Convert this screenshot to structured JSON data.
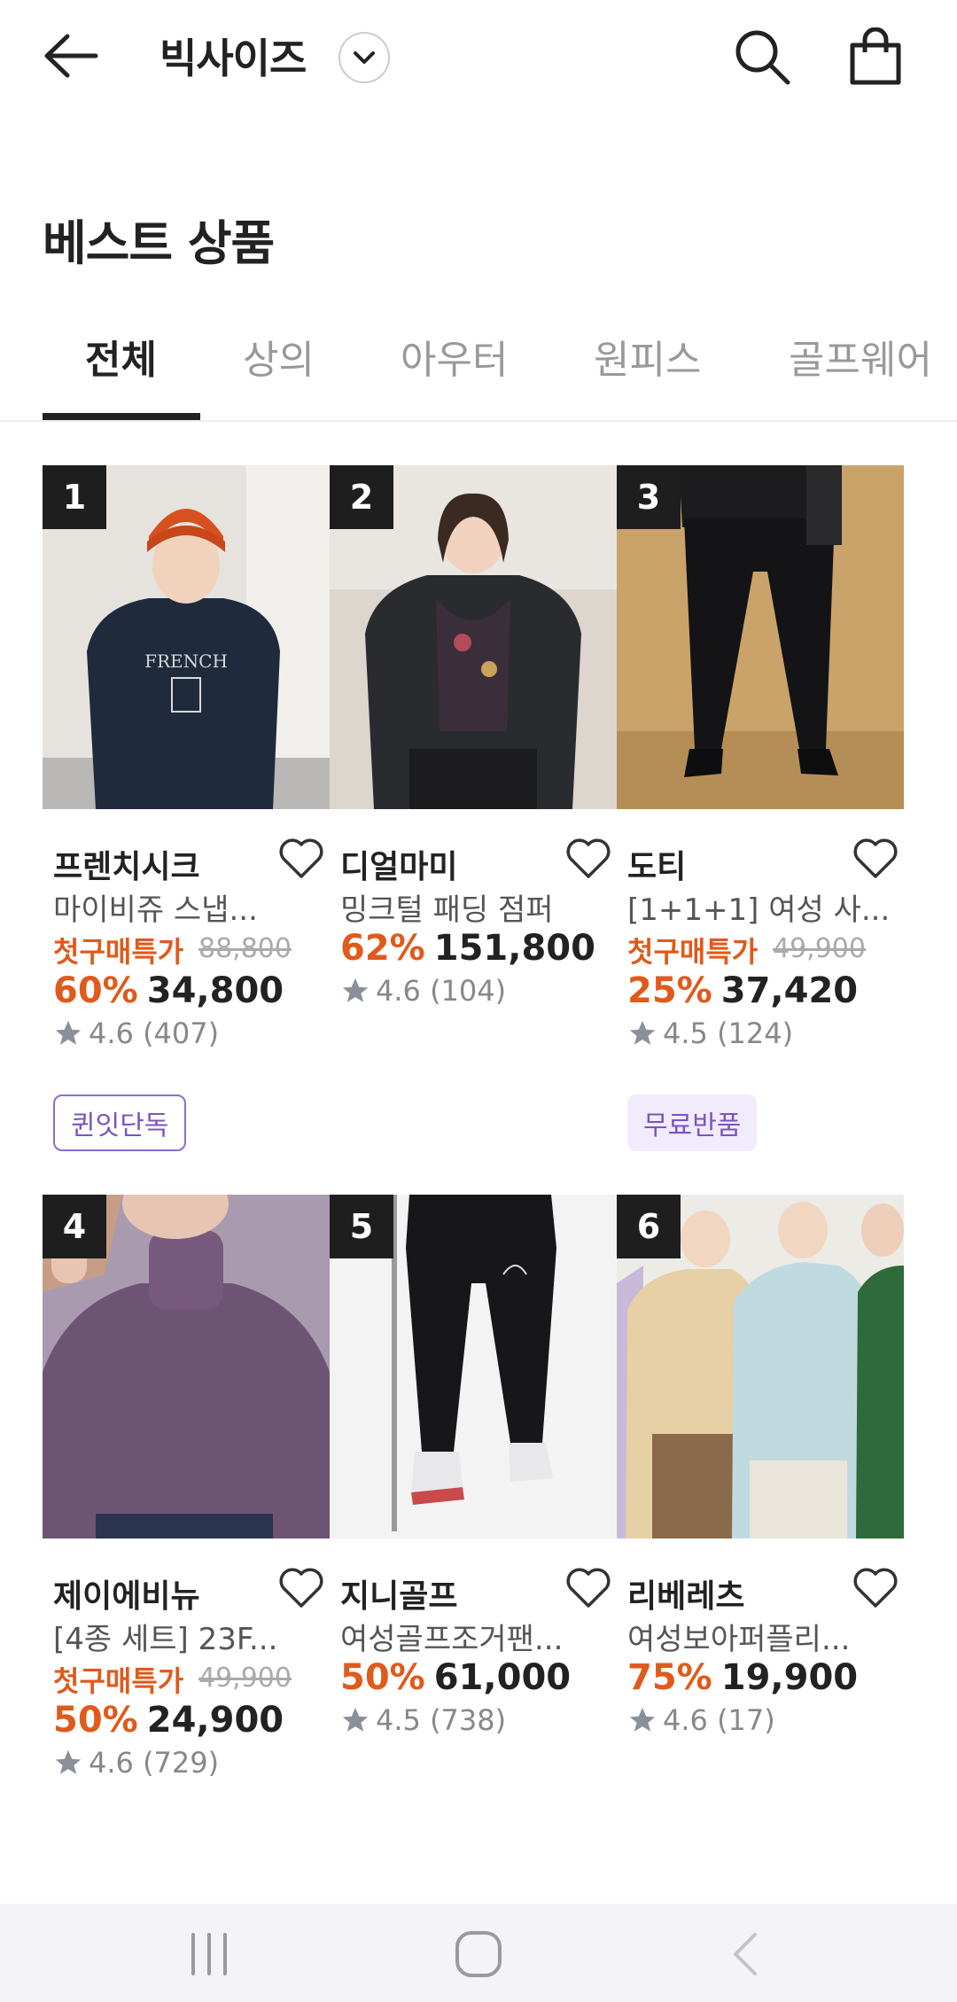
{
  "header": {
    "store_title": "빅사이즈",
    "back_icon": "arrow-left-icon",
    "dropdown_icon": "chevron-down-icon",
    "search_icon": "search-icon",
    "bag_icon": "shopping-bag-icon"
  },
  "section_title": "베스트 상품",
  "tabs": [
    {
      "label": "전체",
      "active": true
    },
    {
      "label": "상의",
      "active": false
    },
    {
      "label": "아우터",
      "active": false
    },
    {
      "label": "원피스",
      "active": false
    },
    {
      "label": "골프웨어",
      "active": false
    }
  ],
  "products": [
    {
      "rank": "1",
      "brand": "프렌치시크",
      "name": "마이비쥬 스냅...",
      "promo": "첫구매특가",
      "original_price": "88,800",
      "discount": "60%",
      "price": "34,800",
      "rating": "4.6",
      "reviews": "(407)",
      "badge": "퀸잇단독"
    },
    {
      "rank": "2",
      "brand": "디얼마미",
      "name": "밍크털 패딩 점퍼",
      "promo": "",
      "original_price": "",
      "discount": "62%",
      "price": "151,800",
      "rating": "4.6",
      "reviews": "(104)",
      "badge": ""
    },
    {
      "rank": "3",
      "brand": "도티",
      "name": "[1+1+1] 여성 사...",
      "promo": "첫구매특가",
      "original_price": "49,900",
      "discount": "25%",
      "price": "37,420",
      "rating": "4.5",
      "reviews": "(124)",
      "badge": "무료반품"
    },
    {
      "rank": "4",
      "brand": "제이에비뉴",
      "name": "[4종 세트] 23F...",
      "promo": "첫구매특가",
      "original_price": "49,900",
      "discount": "50%",
      "price": "24,900",
      "rating": "4.6",
      "reviews": "(729)",
      "badge": ""
    },
    {
      "rank": "5",
      "brand": "지니골프",
      "name": "여성골프조거팬...",
      "promo": "",
      "original_price": "",
      "discount": "50%",
      "price": "61,000",
      "rating": "4.5",
      "reviews": "(738)",
      "badge": ""
    },
    {
      "rank": "6",
      "brand": "리베레츠",
      "name": "여성보아퍼플리...",
      "promo": "",
      "original_price": "",
      "discount": "75%",
      "price": "19,900",
      "rating": "4.6",
      "reviews": "(17)",
      "badge": ""
    }
  ],
  "colors": {
    "accent_orange": "#e05a1b",
    "badge_purple": "#7a55c0",
    "rank_bg": "#1e1e1e"
  },
  "system_nav": {
    "recent_icon": "recent-apps-icon",
    "home_icon": "home-icon",
    "back_icon": "back-icon"
  }
}
